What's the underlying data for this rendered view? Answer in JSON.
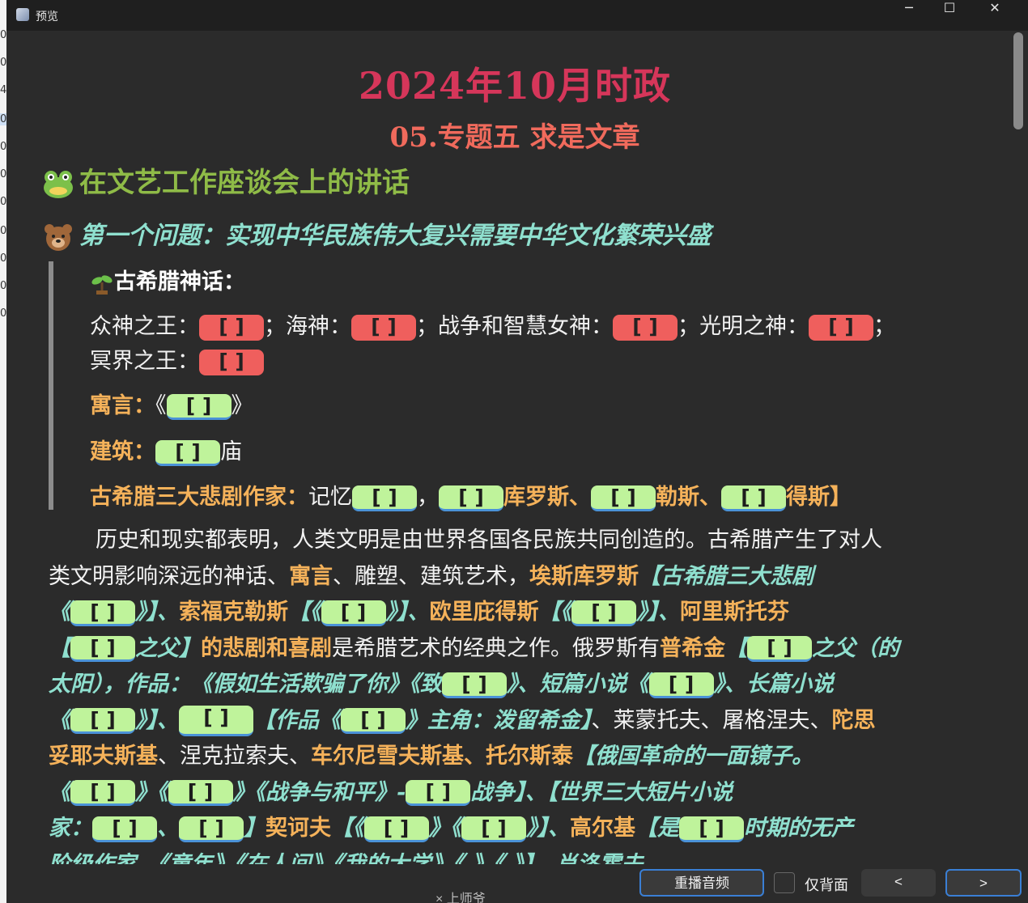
{
  "window": {
    "title": "预览",
    "minimize": "─",
    "maximize": "☐",
    "close": "✕"
  },
  "left_strip": [
    "0",
    "0",
    "0",
    "4",
    "0",
    "0",
    "0",
    "0",
    "0",
    "0",
    "0",
    "0"
  ],
  "heading": {
    "title": "2024年10月时政",
    "subtitle": "05.专题五 求是文章"
  },
  "section": {
    "title": "在文艺工作座谈会上的讲话",
    "frog_icon": "frog-face-icon"
  },
  "subsection": {
    "title": "第一个问题：实现中华民族伟大复兴需要中华文化繁荣兴盛",
    "bear_icon": "bear-face-icon"
  },
  "quote": {
    "heading": "古希腊神话：",
    "line1": {
      "a": "众神之王：",
      "b": "；海神：",
      "c": "；战争和智慧女神：",
      "d": "；光明之神：",
      "e": "；"
    },
    "line2": {
      "a": "冥界之王："
    },
    "fable_label": "寓言：",
    "fable_pre": "《",
    "fable_post": "》",
    "arch_label": "建筑：",
    "arch_post": "庙",
    "tragedy_label": "古希腊三大悲剧作家：",
    "tragedy_a": "记忆",
    "tragedy_b": "，",
    "tragedy_c": "库罗斯、",
    "tragedy_d": "勒斯、",
    "tragedy_e": "得斯】"
  },
  "blank": "[    ]",
  "para": {
    "l1": "历史和现实都表明，人类文明是由世界各国各民族共同创造的。古希腊产生了对人",
    "l2a": "类文明影响深远的神话、",
    "l2b": "寓言",
    "l2c": "、雕塑、建筑艺术，",
    "l2d": "埃斯库罗斯",
    "l2e": "【古希腊三大悲剧",
    "l3a": "《",
    "l3b": "》】、",
    "l3c": "索福克勒斯",
    "l3d": "【《",
    "l3e": "》】、",
    "l3f": "欧里庇得斯",
    "l3g": "【《",
    "l3h": "》】、",
    "l3i": "阿里斯托芬",
    "l4a": "【",
    "l4b": "之父】",
    "l4c": "的悲剧和喜剧",
    "l4d": "是希腊艺术的经典之作。俄罗斯有",
    "l4e": "普希金",
    "l4f": "【",
    "l4g": "之父（的",
    "l5a": "太阳），作品：《假如生活欺骗了你》《致",
    "l5b": "》、短篇小说《",
    "l5c": "》、长篇小说",
    "l6a": "《",
    "l6b": "》】、",
    "l6c": "【作品《",
    "l6d": "》主角：泼留希金】",
    "l6e": "、莱蒙托夫、屠格涅夫、",
    "l6f": "陀思",
    "l7a": "妥耶夫斯基",
    "l7b": "、涅克拉索夫、",
    "l7c": "车尔尼雪夫斯基、托尔斯泰",
    "l7d": "【俄国革命的一面镜子。",
    "l8a": "《",
    "l8b": "》《",
    "l8c": "》《战争与和平》-",
    "l8d": "战争】、【世界三大短片小说",
    "l9a": "家：",
    "l9b": "、",
    "l9c": "】",
    "l9d": "契诃夫",
    "l9e": "【《",
    "l9f": "》《",
    "l9g": "》】、",
    "l9h": "高尔基",
    "l9i": "【是",
    "l9j": "时期的无产",
    "l10": "阶级作家。《童年》《在人间》《我的大学》《            》《            》】、肖洛霍夫"
  },
  "buttons": {
    "replay": "重播音频",
    "back_only": "仅背面",
    "prev": "<",
    "next": ">"
  },
  "under_text": "× 上师爷"
}
